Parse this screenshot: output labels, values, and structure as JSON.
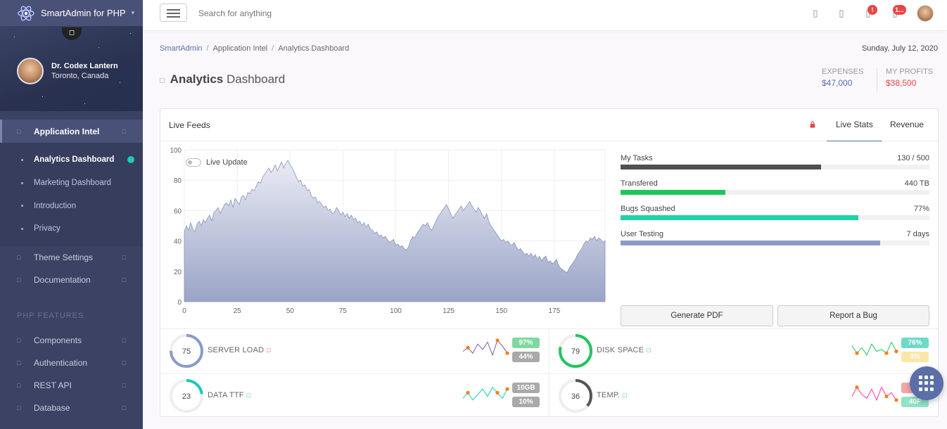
{
  "app": {
    "title": "SmartAdmin for PHP"
  },
  "user": {
    "name": "Dr. Codex Lantern",
    "location": "Toronto, Canada"
  },
  "nav": {
    "application_intel": "Application Intel",
    "sub": [
      "Analytics Dashboard",
      "Marketing Dashboard",
      "Introduction",
      "Privacy"
    ],
    "theme_settings": "Theme Settings",
    "documentation": "Documentation",
    "section_php": "PHP FEATURES",
    "php_items": [
      "Components",
      "Authentication",
      "REST API",
      "Database"
    ]
  },
  "header": {
    "search_placeholder": "Search for anything",
    "badges": [
      "!",
      "1..."
    ]
  },
  "breadcrumb": [
    "SmartAdmin",
    "Application Intel",
    "Analytics Dashboard"
  ],
  "date": "Sunday, July 12, 2020",
  "page": {
    "title_bold": "Analytics",
    "title_rest": "Dashboard"
  },
  "stats": {
    "expenses_label": "EXPENSES",
    "expenses_value": "$47,000",
    "profits_label": "MY PROFITS",
    "profits_value": "$38,500"
  },
  "panel": {
    "title": "Live Feeds",
    "tabs": [
      "Live Stats",
      "Revenue"
    ],
    "live_update_label": "Live Update",
    "progress": [
      {
        "label": "My Tasks",
        "value": "130 / 500",
        "fraction": 0.65,
        "color": "#505050"
      },
      {
        "label": "Transfered",
        "value": "440 TB",
        "fraction": 0.34,
        "color": "#21c55d"
      },
      {
        "label": "Bugs Squashed",
        "value": "77%",
        "fraction": 0.77,
        "color": "#1dd3a7"
      },
      {
        "label": "User Testing",
        "value": "7 days",
        "fraction": 0.84,
        "color": "#8a9bc9"
      }
    ],
    "buttons": [
      "Generate PDF",
      "Report a Bug"
    ]
  },
  "minis": [
    {
      "name": "SERVER LOAD",
      "value": "75",
      "percent": 75,
      "ring_color": "#8a9bc9",
      "pill1": "97%",
      "pill1_color": "#7fd8a0",
      "pill2": "44%",
      "pill2_color": "#a9a9a9",
      "tick_color": "#e94545"
    },
    {
      "name": "DISK SPACE",
      "value": "79",
      "percent": 79,
      "ring_color": "#21c55d",
      "pill1": "76%",
      "pill1_color": "#6fd9c6",
      "pill2": "3%",
      "pill2_color": "#fbe6a8",
      "tick_color": "#21c55d"
    },
    {
      "name": "DATA TTF",
      "value": "23",
      "percent": 23,
      "ring_color": "#1dc9b7",
      "pill1": "10GB",
      "pill1_color": "#a9a9a9",
      "pill2": "10%",
      "pill2_color": "#a9a9a9",
      "tick_color": "#21c55d"
    },
    {
      "name": "TEMP.",
      "value": "36",
      "percent": 36,
      "ring_color": "#555555",
      "pill1": "",
      "pill1_color": "#f4a6a6",
      "pill2": "40F",
      "pill2_color": "#8fe3c8",
      "tick_color": "#21c55d"
    }
  ],
  "chart_data": {
    "type": "area",
    "x_ticks": [
      0,
      25,
      50,
      75,
      100,
      125,
      150,
      175
    ],
    "y_ticks": [
      0,
      20,
      40,
      60,
      80,
      100
    ],
    "xlim": [
      0,
      199
    ],
    "ylim": [
      0,
      100
    ],
    "values": [
      46,
      50,
      47,
      52,
      48,
      46,
      51,
      53,
      50,
      54,
      52,
      55,
      57,
      53,
      59,
      60,
      62,
      58,
      61,
      64,
      65,
      63,
      67,
      62,
      68,
      66,
      64,
      69,
      70,
      67,
      72,
      71,
      74,
      73,
      76,
      79,
      78,
      82,
      84,
      86,
      88,
      85,
      87,
      90,
      86,
      89,
      92,
      88,
      91,
      93,
      90,
      88,
      85,
      82,
      79,
      80,
      76,
      77,
      73,
      74,
      70,
      68,
      69,
      65,
      66,
      64,
      62,
      63,
      60,
      61,
      58,
      59,
      62,
      60,
      57,
      59,
      56,
      58,
      55,
      57,
      54,
      55,
      52,
      53,
      50,
      52,
      49,
      51,
      48,
      47,
      45,
      46,
      43,
      44,
      42,
      43,
      41,
      39,
      40,
      41,
      37,
      38,
      36,
      37,
      35,
      34,
      36,
      40,
      43,
      42,
      45,
      47,
      49,
      51,
      50,
      52,
      49,
      47,
      50,
      53,
      56,
      58,
      60,
      62,
      64,
      61,
      58,
      55,
      57,
      59,
      61,
      63,
      60,
      62,
      64,
      66,
      63,
      61,
      59,
      62,
      60,
      57,
      55,
      58,
      53,
      50,
      48,
      46,
      44,
      42,
      40,
      41,
      39,
      40,
      38,
      37,
      39,
      36,
      34,
      35,
      33,
      31,
      32,
      30,
      32,
      29,
      31,
      28,
      30,
      27,
      29,
      30,
      26,
      27,
      25,
      26,
      28,
      24,
      22,
      21,
      20,
      19,
      22,
      24,
      26,
      28,
      31,
      33,
      35,
      38,
      40,
      39,
      42,
      41,
      43,
      40,
      42,
      41,
      39,
      40
    ]
  },
  "sparks": [
    [
      4,
      6,
      3,
      8,
      5,
      9,
      2,
      10,
      7,
      3
    ],
    [
      7,
      3,
      6,
      2,
      8,
      4,
      5,
      3,
      9,
      4
    ],
    [
      3,
      6,
      2,
      5,
      8,
      4,
      9,
      6,
      3,
      8
    ],
    [
      4,
      9,
      5,
      3,
      8,
      2,
      9,
      4,
      6,
      2
    ]
  ]
}
